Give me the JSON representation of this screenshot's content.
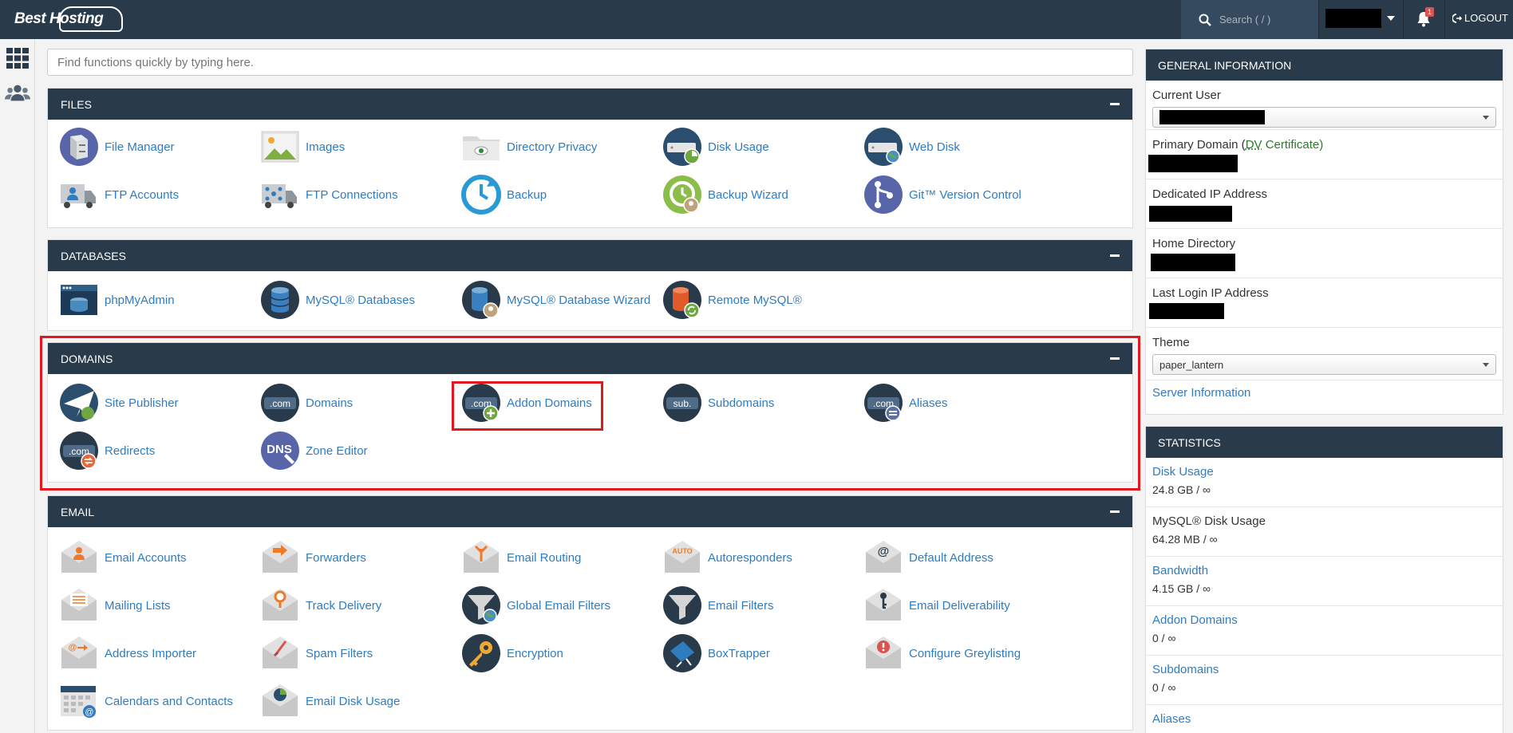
{
  "header": {
    "logo_text": "Best Hosting",
    "search_placeholder": "Search ( / )",
    "notification_count": "1",
    "logout_label": "LOGOUT"
  },
  "quick_search": {
    "placeholder": "Find functions quickly by typing here."
  },
  "sections": [
    {
      "key": "files",
      "title": "FILES",
      "items": [
        {
          "label": "File Manager",
          "icon": "file-manager-icon"
        },
        {
          "label": "Images",
          "icon": "images-icon"
        },
        {
          "label": "Directory Privacy",
          "icon": "directory-privacy-icon"
        },
        {
          "label": "Disk Usage",
          "icon": "disk-usage-icon"
        },
        {
          "label": "Web Disk",
          "icon": "web-disk-icon"
        },
        {
          "label": "FTP Accounts",
          "icon": "ftp-accounts-icon"
        },
        {
          "label": "FTP Connections",
          "icon": "ftp-connections-icon"
        },
        {
          "label": "Backup",
          "icon": "backup-icon"
        },
        {
          "label": "Backup Wizard",
          "icon": "backup-wizard-icon"
        },
        {
          "label": "Git™ Version Control",
          "icon": "git-icon"
        }
      ]
    },
    {
      "key": "databases",
      "title": "DATABASES",
      "items": [
        {
          "label": "phpMyAdmin",
          "icon": "phpmyadmin-icon"
        },
        {
          "label": "MySQL® Databases",
          "icon": "mysql-databases-icon"
        },
        {
          "label": "MySQL® Database Wizard",
          "icon": "mysql-wizard-icon"
        },
        {
          "label": "Remote MySQL®",
          "icon": "remote-mysql-icon"
        }
      ]
    },
    {
      "key": "domains",
      "title": "DOMAINS",
      "items": [
        {
          "label": "Site Publisher",
          "icon": "site-publisher-icon"
        },
        {
          "label": "Domains",
          "icon": "domains-icon"
        },
        {
          "label": "Addon Domains",
          "icon": "addon-domains-icon"
        },
        {
          "label": "Subdomains",
          "icon": "subdomains-icon"
        },
        {
          "label": "Aliases",
          "icon": "aliases-icon"
        },
        {
          "label": "Redirects",
          "icon": "redirects-icon"
        },
        {
          "label": "Zone Editor",
          "icon": "zone-editor-icon"
        }
      ]
    },
    {
      "key": "email",
      "title": "EMAIL",
      "items": [
        {
          "label": "Email Accounts",
          "icon": "email-accounts-icon"
        },
        {
          "label": "Forwarders",
          "icon": "forwarders-icon"
        },
        {
          "label": "Email Routing",
          "icon": "email-routing-icon"
        },
        {
          "label": "Autoresponders",
          "icon": "autoresponders-icon"
        },
        {
          "label": "Default Address",
          "icon": "default-address-icon"
        },
        {
          "label": "Mailing Lists",
          "icon": "mailing-lists-icon"
        },
        {
          "label": "Track Delivery",
          "icon": "track-delivery-icon"
        },
        {
          "label": "Global Email Filters",
          "icon": "global-email-filters-icon"
        },
        {
          "label": "Email Filters",
          "icon": "email-filters-icon"
        },
        {
          "label": "Email Deliverability",
          "icon": "email-deliverability-icon"
        },
        {
          "label": "Address Importer",
          "icon": "address-importer-icon"
        },
        {
          "label": "Spam Filters",
          "icon": "spam-filters-icon"
        },
        {
          "label": "Encryption",
          "icon": "encryption-icon"
        },
        {
          "label": "BoxTrapper",
          "icon": "boxtrapper-icon"
        },
        {
          "label": "Configure Greylisting",
          "icon": "greylisting-icon"
        },
        {
          "label": "Calendars and Contacts",
          "icon": "calendars-contacts-icon"
        },
        {
          "label": "Email Disk Usage",
          "icon": "email-disk-usage-icon"
        }
      ]
    }
  ],
  "general_info": {
    "title": "GENERAL INFORMATION",
    "current_user_label": "Current User",
    "primary_domain_label_prefix": "Primary Domain (",
    "primary_domain_dv": "DV",
    "primary_domain_label_suffix": " Certificate)",
    "dedicated_ip_label": "Dedicated IP Address",
    "home_dir_label": "Home Directory",
    "last_login_label": "Last Login IP Address",
    "theme_label": "Theme",
    "theme_value": "paper_lantern",
    "server_info_link": "Server Information"
  },
  "statistics": {
    "title": "STATISTICS",
    "items": [
      {
        "label": "Disk Usage",
        "value": "24.8 GB / ∞",
        "link": true
      },
      {
        "label": "MySQL® Disk Usage",
        "value": "64.28 MB / ∞",
        "link": false
      },
      {
        "label": "Bandwidth",
        "value": "4.15 GB / ∞",
        "link": true
      },
      {
        "label": "Addon Domains",
        "value": "0 / ∞",
        "link": true
      },
      {
        "label": "Subdomains",
        "value": "0 / ∞",
        "link": true
      },
      {
        "label": "Aliases",
        "value": "",
        "link": true
      }
    ]
  },
  "colors": {
    "header_bg": "#293a4a",
    "link": "#2f7cc0",
    "highlight": "#e3181f"
  }
}
